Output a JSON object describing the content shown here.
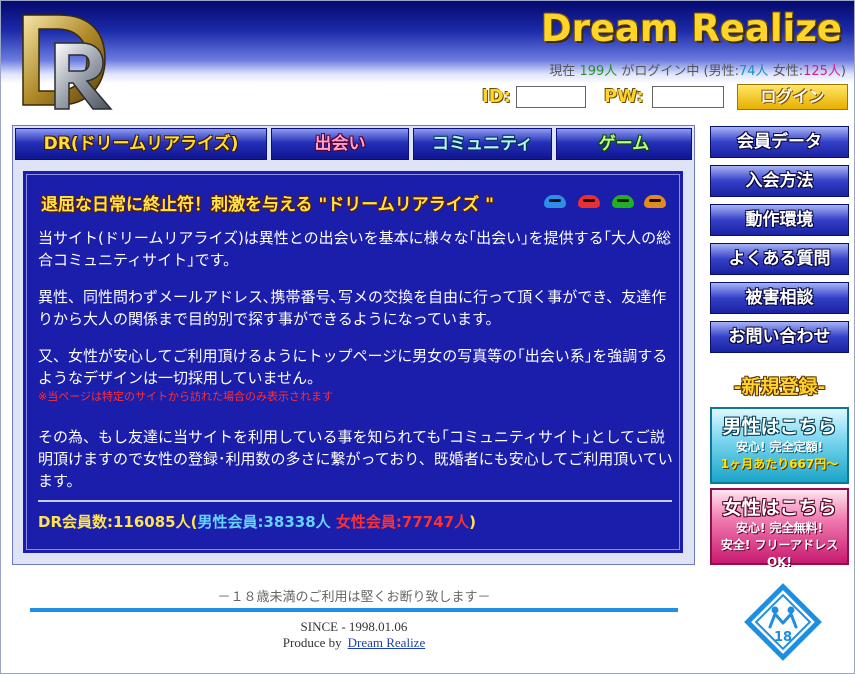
{
  "header": {
    "site_title": "Dream Realize",
    "logo_text": "DR",
    "status": {
      "prefix": "現在",
      "online": "199人",
      "mid": "がログイン中 (男性:",
      "male": "74人",
      "sep": "女性:",
      "female": "125人",
      "suffix": ")"
    },
    "login": {
      "id_label": "ID:",
      "pw_label": "PW:",
      "button": "ログイン",
      "id_value": "",
      "pw_value": ""
    }
  },
  "tabs": [
    {
      "label": "DR(ドリームリアライズ)"
    },
    {
      "label": "出会い"
    },
    {
      "label": "コミュニティ"
    },
    {
      "label": "ゲーム"
    }
  ],
  "content": {
    "headline": "退屈な日常に終止符！刺激を与える \"ドリームリアライズ \"",
    "p1": "当サイト(ドリームリアライズ)は異性との出会いを基本に様々な｢出会い｣を提供する｢大人の総合コミュニティサイト｣です。",
    "p2": "異性、同性問わずメールアドレス､携帯番号､写メの交換を自由に行って頂く事ができ、友達作りから大人の関係まで目的別で探す事ができるようになっています。",
    "p3": "又、女性が安心してご利用頂けるようにトップページに男女の写真等の｢出会い系｣を強調するようなデザインは一切採用していません。",
    "note": "※当ページは特定のサイトから訪れた場合のみ表示されます",
    "p4": "その為、もし友達に当サイトを利用している事を知られても｢コミュニティサイト｣としてご説明頂けますので女性の登録･利用数の多さに繋がっており、既婚者にも安心してご利用頂いています。",
    "counts": {
      "total": "DR会員数:116085人(",
      "male": "男性会員:38338人",
      "female": "女性会員:77747人",
      "close": ")"
    },
    "blob_colors": [
      "#2f8fe8",
      "#e83030",
      "#20b020",
      "#e08a20"
    ]
  },
  "sidebar": {
    "items": [
      {
        "label": "会員データ"
      },
      {
        "label": "入会方法"
      },
      {
        "label": "動作環境"
      },
      {
        "label": "よくある質問"
      },
      {
        "label": "被害相談"
      },
      {
        "label": "お問い合わせ"
      }
    ],
    "register_title": "-新規登録-",
    "male": {
      "head": "男性はこちら",
      "line1": "安心! 完全定額!",
      "line2": "1ヶ月あたり667円～"
    },
    "female": {
      "head": "女性はこちら",
      "line1": "安心! 完全無料!",
      "line2": "安全! フリーアドレスOK!"
    }
  },
  "footer": {
    "notice": "－１８歳未満のご利用は堅くお断り致します－",
    "since": "SINCE - 1998.01.06",
    "produce_label": "Produce by",
    "produce_link": "Dream Realize",
    "age_mark": "18"
  }
}
